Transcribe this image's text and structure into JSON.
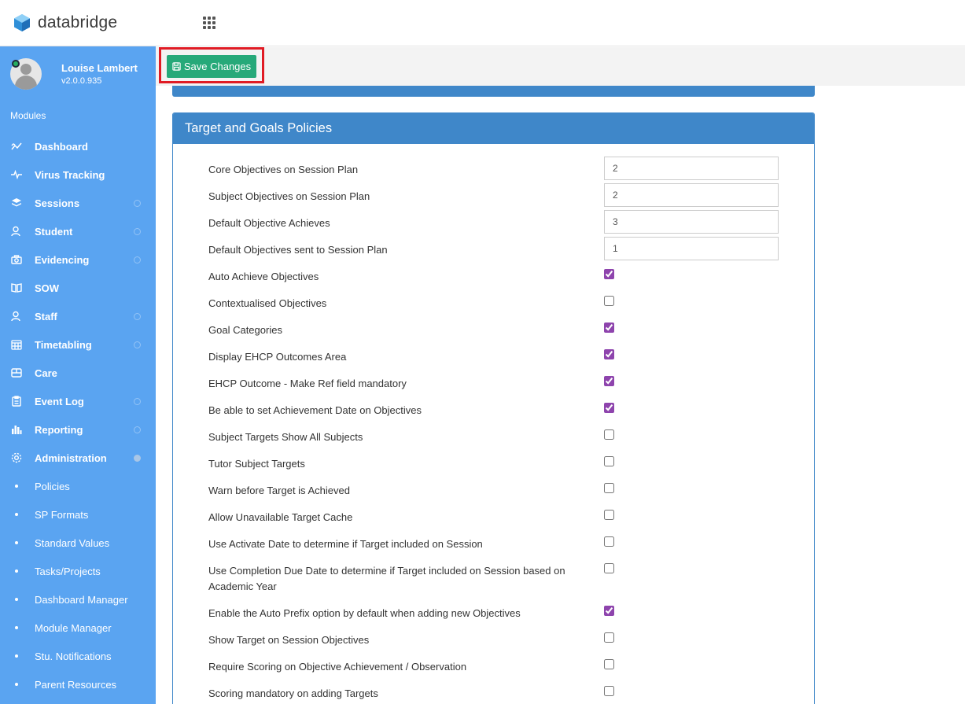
{
  "header": {
    "brand_name": "databridge",
    "logo_icon": "cube-logo-icon",
    "apps_icon": "grid-apps-icon"
  },
  "sidebar": {
    "user_name": "Louise Lambert",
    "version": "v2.0.0.935",
    "modules_label": "Modules",
    "items": [
      {
        "label": "Dashboard",
        "icon": "chart-line-icon"
      },
      {
        "label": "Virus Tracking",
        "icon": "pulse-icon"
      },
      {
        "label": "Sessions",
        "icon": "layers-icon"
      },
      {
        "label": "Student",
        "icon": "users-icon"
      },
      {
        "label": "Evidencing",
        "icon": "camera-icon"
      },
      {
        "label": "SOW",
        "icon": "book-icon"
      },
      {
        "label": "Staff",
        "icon": "users-icon"
      },
      {
        "label": "Timetabling",
        "icon": "calendar-icon"
      },
      {
        "label": "Care",
        "icon": "care-icon"
      },
      {
        "label": "Event Log",
        "icon": "clipboard-icon"
      },
      {
        "label": "Reporting",
        "icon": "bar-chart-icon"
      },
      {
        "label": "Administration",
        "icon": "gear-icon"
      }
    ],
    "subitems": [
      {
        "label": "Policies"
      },
      {
        "label": "SP Formats"
      },
      {
        "label": "Standard Values"
      },
      {
        "label": "Tasks/Projects"
      },
      {
        "label": "Dashboard Manager"
      },
      {
        "label": "Module Manager"
      },
      {
        "label": "Stu. Notifications"
      },
      {
        "label": "Parent Resources"
      }
    ]
  },
  "toolbar": {
    "save_label": "Save Changes"
  },
  "panel": {
    "title": "Target and Goals Policies",
    "rows": [
      {
        "label": "Core Objectives on Session Plan",
        "value": "2"
      },
      {
        "label": "Subject Objectives on Session Plan",
        "value": "2"
      },
      {
        "label": "Default Objective Achieves",
        "value": "3"
      },
      {
        "label": "Default Objectives sent to Session Plan",
        "value": "1"
      },
      {
        "label": "Auto Achieve Objectives",
        "checked": true
      },
      {
        "label": "Contextualised Objectives",
        "checked": false
      },
      {
        "label": "Goal Categories",
        "checked": true
      },
      {
        "label": "Display EHCP Outcomes Area",
        "checked": true
      },
      {
        "label": "EHCP Outcome - Make Ref field mandatory",
        "checked": true
      },
      {
        "label": "Be able to set Achievement Date on Objectives",
        "checked": true
      },
      {
        "label": "Subject Targets Show All Subjects",
        "checked": false
      },
      {
        "label": "Tutor Subject Targets",
        "checked": false
      },
      {
        "label": "Warn before Target is Achieved",
        "checked": false
      },
      {
        "label": "Allow Unavailable Target Cache",
        "checked": false
      },
      {
        "label": "Use Activate Date to determine if Target included on Session",
        "checked": false
      },
      {
        "label": "Use Completion Due Date to determine if Target included on Session based on Academic Year",
        "checked": false
      },
      {
        "label": "Enable the Auto Prefix option by default when adding new Objectives",
        "checked": true
      },
      {
        "label": "Show Target on Session Objectives",
        "checked": false
      },
      {
        "label": "Require Scoring on Objective Achievement / Observation",
        "checked": false
      },
      {
        "label": "Scoring mandatory on adding Targets",
        "checked": false
      }
    ]
  },
  "colors": {
    "sidebar_bg": "#5aa4f1",
    "panel_header": "#3f87c9",
    "save_button": "#26a979",
    "highlight": "#e01b24",
    "checkbox_accent": "#8e44ad"
  }
}
